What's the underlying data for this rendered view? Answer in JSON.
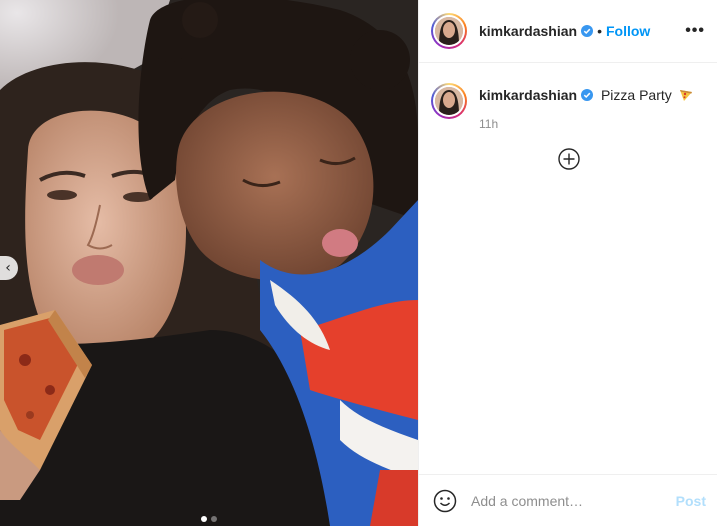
{
  "post": {
    "photo_alt": "",
    "carousel": {
      "count": 2,
      "active_index": 1
    },
    "prev_icon": "chevron-left-icon"
  },
  "header": {
    "username": "kimkardashian",
    "separator": "•",
    "follow_label": "Follow",
    "more_label": "•••"
  },
  "caption": {
    "username": "kimkardashian",
    "text": "Pizza Party",
    "emoji": "pizza-icon",
    "time": "11h"
  },
  "comments": {
    "load_more_icon": "plus-circle-icon"
  },
  "comment_bar": {
    "emoji_icon": "smiley-icon",
    "placeholder": "Add a comment…",
    "post_label": "Post"
  },
  "colors": {
    "link_blue": "#0095f6",
    "post_disabled": "#b2dffc",
    "muted": "#8e8e8e",
    "verified_blue": "#3897f0"
  }
}
